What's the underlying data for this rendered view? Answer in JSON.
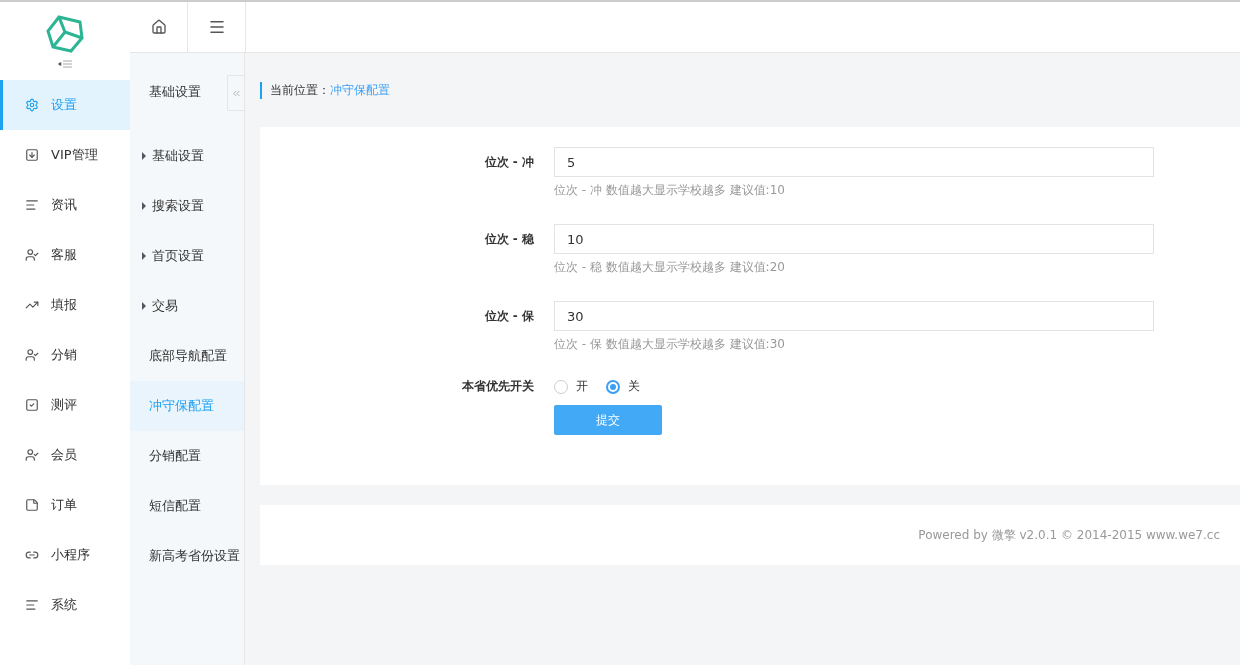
{
  "nav": {
    "items": [
      {
        "label": "设置",
        "selected": true
      },
      {
        "label": "VIP管理",
        "selected": false
      },
      {
        "label": "资讯",
        "selected": false
      },
      {
        "label": "客服",
        "selected": false
      },
      {
        "label": "填报",
        "selected": false
      },
      {
        "label": "分销",
        "selected": false
      },
      {
        "label": "测评",
        "selected": false
      },
      {
        "label": "会员",
        "selected": false
      },
      {
        "label": "订单",
        "selected": false
      },
      {
        "label": "小程序",
        "selected": false
      },
      {
        "label": "系统",
        "selected": false
      }
    ]
  },
  "subnav": {
    "title": "基础设置",
    "items": [
      {
        "label": "基础设置",
        "kind": "group",
        "selected": false
      },
      {
        "label": "搜索设置",
        "kind": "group",
        "selected": false
      },
      {
        "label": "首页设置",
        "kind": "group",
        "selected": false
      },
      {
        "label": "交易",
        "kind": "group",
        "selected": false
      },
      {
        "label": "底部导航配置",
        "kind": "link",
        "selected": false
      },
      {
        "label": "冲守保配置",
        "kind": "link",
        "selected": true
      },
      {
        "label": "分销配置",
        "kind": "link",
        "selected": false
      },
      {
        "label": "短信配置",
        "kind": "link",
        "selected": false
      },
      {
        "label": "新高考省份设置",
        "kind": "link",
        "selected": false
      }
    ]
  },
  "breadcrumb": {
    "label": "当前位置：",
    "current": "冲守保配置"
  },
  "form": {
    "fields": [
      {
        "label": "位次 - 冲",
        "value": "5",
        "hint": "位次 - 冲 数值越大显示学校越多 建议值:10"
      },
      {
        "label": "位次 - 稳",
        "value": "10",
        "hint": "位次 - 稳 数值越大显示学校越多 建议值:20"
      },
      {
        "label": "位次 - 保",
        "value": "30",
        "hint": "位次 - 保 数值越大显示学校越多 建议值:30"
      }
    ],
    "radio": {
      "label": "本省优先开关",
      "options": [
        {
          "label": "开",
          "selected": false
        },
        {
          "label": "关",
          "selected": true
        }
      ]
    },
    "submit": "提交"
  },
  "footer": "Powered by 微擎 v2.0.1 © 2014-2015 www.we7.cc"
}
